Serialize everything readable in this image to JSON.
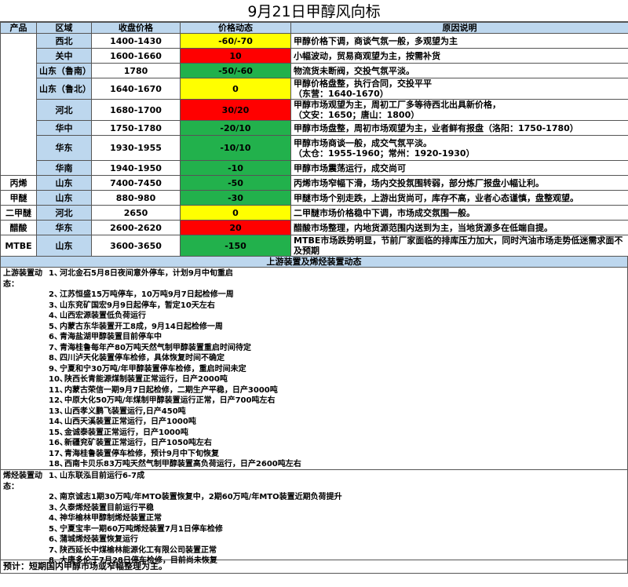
{
  "title": "9月21日甲醇风向标",
  "headers": [
    "产品",
    "区域",
    "收盘价格",
    "价格动态",
    "原因说明"
  ],
  "rows": [
    {
      "product": "",
      "region": "西北",
      "price": "1400-1430",
      "change": "-60/-70",
      "color": "yellow",
      "reason": "甲醇价格下调，商谈气氛一般，多观望为主"
    },
    {
      "product": "",
      "region": "关中",
      "price": "1600-1660",
      "change": "10",
      "color": "red",
      "reason": "小幅波动，贸易商观望为主，按需补货"
    },
    {
      "product": "",
      "region": "山东（鲁南）",
      "price": "1780",
      "change": "-50/-60",
      "color": "green",
      "reason": "物流货未断阀，交投气氛平淡。"
    },
    {
      "product": "",
      "region": "山东（鲁北）",
      "price": "1640-1670",
      "change": "0",
      "color": "yellow",
      "reason": "甲醇价格盘整，执行合同，交投平平\n（东营：1640-1670）"
    },
    {
      "product": "",
      "region": "河北",
      "price": "1680-1700",
      "change": "30/20",
      "color": "red",
      "reason": "甲醇市场观望为主，周初工厂多等待西北出具新价格，\n（文安：1650；唐山：1800）"
    },
    {
      "product": "",
      "region": "华中",
      "price": "1750-1780",
      "change": "-20/10",
      "color": "green",
      "reason": "甲醇市场盘整，周初市场观望为主，业者鲜有报盘（洛阳：1750-1780）"
    },
    {
      "product": "",
      "region": "华东",
      "price": "1930-1955",
      "change": "-10/10",
      "color": "green",
      "reason": "甲醇市场商谈一般，成交气氛平淡。\n（太仓：1955-1960；常州：1920-1930）"
    },
    {
      "product": "",
      "region": "华南",
      "price": "1940-1950",
      "change": "-10",
      "color": "green",
      "reason": "甲醇市场震荡运行，成交尚可"
    },
    {
      "product": "丙烯",
      "region": "山东",
      "price": "7400-7450",
      "change": "-50",
      "color": "green",
      "reason": "丙烯市场窄幅下滑，场内交投氛围转弱，部分炼厂报盘小幅让利。"
    },
    {
      "product": "甲醚",
      "region": "山东",
      "price": "880-980",
      "change": "-30",
      "color": "green",
      "reason": "甲醚市场个别走跌，上游出货尚可，库存不高，业者心态谨慎，盘整观望。"
    },
    {
      "product": "二甲醚",
      "region": "河北",
      "price": "2650",
      "change": "0",
      "color": "yellow",
      "reason": "二甲醚市场价格稳中下调，市场成交氛围一般。"
    },
    {
      "product": "醋酸",
      "region": "华东",
      "price": "2600-2620",
      "change": "20",
      "color": "red",
      "reason": "醋酸市场整理，内地货源范围内送到为主，当地货源多在低端自提。"
    },
    {
      "product": "MTBE",
      "region": "山东",
      "price": "3600-3650",
      "change": "-150",
      "color": "green",
      "reason": "MTBE市场跌势明显，节前厂家面临的排库压力加大，同时汽油市场走势低迷需求面不及预期"
    }
  ],
  "section_title": "上游装置及烯烃装置动态",
  "upstream": {
    "label": "上游装置动态：",
    "items": [
      "河北金石5月8日夜间意外停车，计划9月中旬重启",
      "江苏恒盛15万吨停车，10万吨9月7日起检修一周",
      "山东兖矿国宏9月9日起停车，暂定10天左右",
      "山西宏源装置低负荷运行",
      "内蒙古东华装置开工8成，9月14日起检修一周",
      "青海盐湖甲醇装置目前停车中",
      "青海桂鲁每年产80万吨天然气制甲醇装置重启时间待定",
      "四川泸天化装置停车检修，具体恢复时间不确定",
      "宁夏和宁30万吨/年甲醇装置停车检修，重启时间未定",
      "陕西长青能源煤制装置正常运行，日产2000吨",
      "内蒙古荣信一期9月7日起检修，二期生产平稳，日产3000吨",
      "中原大化50万吨/年煤制甲醇装置运行正常，日产700吨左右",
      "山西孝义鹏飞装置运行,日产450吨",
      "山西天溪装置正常运行，日产1000吨",
      "金诚泰装置正常运行，日产1000吨",
      "新疆兖矿装置正常运行，日产1050吨左右",
      "青海桂鲁装置停车检修，预计9月中下旬恢复",
      "西南卡贝乐83万吨天然气制甲醇装置高负荷运行，日产2600吨左右"
    ]
  },
  "olefin": {
    "label": "烯烃装置动态：",
    "items": [
      "山东联泓目前运行6-7成",
      "南京诚志1期30万吨/年MTO装置恢复中，2期60万吨/年MTO装置近期负荷提升",
      "久泰烯烃装置目前运行平稳",
      "神华榆林甲醇制烯烃装置正常",
      "宁夏宝丰一期60万吨烯烃装置7月1日停车检修",
      "蒲城烯烃装置恢复运行",
      "陕西延长中煤榆林能源化工有限公司装置正常",
      "大唐多伦于7月28日停车检修，目前尚未恢复"
    ]
  },
  "forecast": "预计：短期国内甲醇市场或窄幅整理为主。"
}
